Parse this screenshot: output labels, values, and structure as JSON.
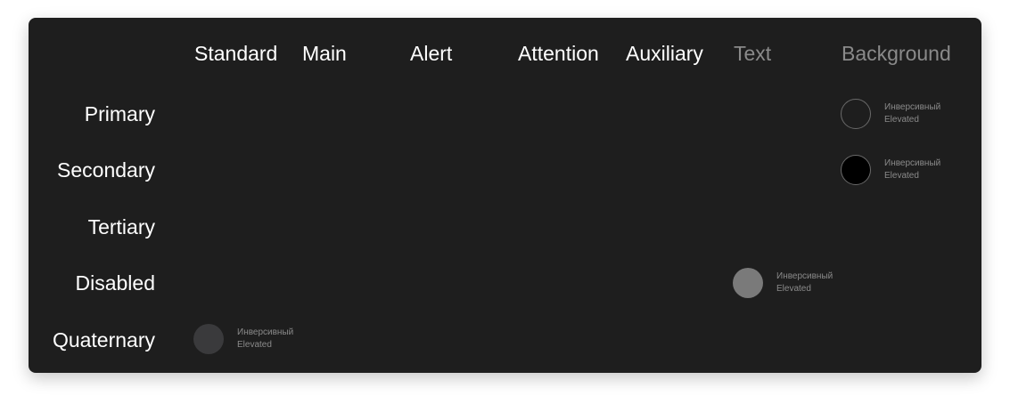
{
  "columns": [
    "Standard",
    "Main",
    "Alert",
    "Attention",
    "Auxiliary",
    "Text",
    "Background"
  ],
  "rows": [
    "Primary",
    "Secondary",
    "Tertiary",
    "Disabled",
    "Quaternary"
  ],
  "swatches": {
    "background_primary": {
      "line1": "Инверсивный",
      "line2": "Elevated",
      "color": "#1e1e1e",
      "border": "#6a6a6a"
    },
    "background_secondary": {
      "line1": "Инверсивный",
      "line2": "Elevated",
      "color": "#000000",
      "border": "#6a6a6a"
    },
    "text_disabled": {
      "line1": "Инверсивный",
      "line2": "Elevated",
      "color": "#7a7a7a"
    },
    "standard_quaternary": {
      "line1": "Инверсивный",
      "line2": "Elevated",
      "color": "#3a3a3c"
    }
  },
  "colors": {
    "panel": "#1e1e1e",
    "header_text": "#ffffff",
    "muted_header_text": "#8a8a8a"
  }
}
